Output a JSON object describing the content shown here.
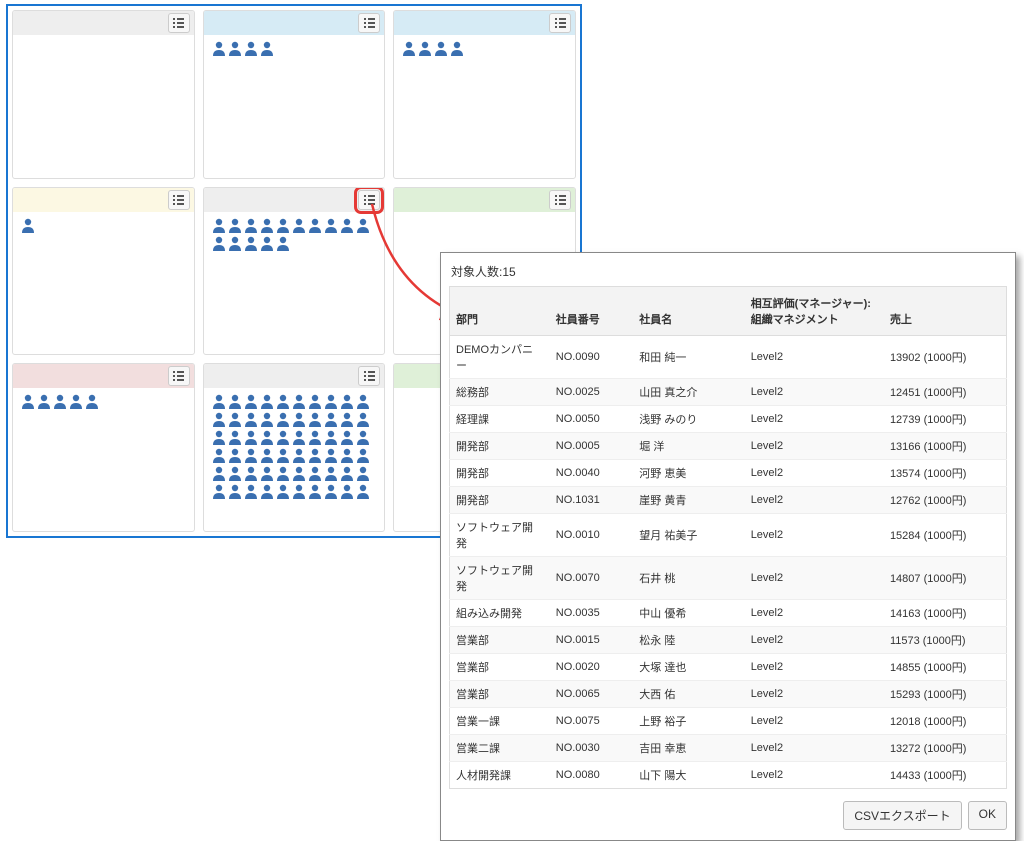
{
  "grid": {
    "cells": [
      {
        "header": "gray",
        "people": 0
      },
      {
        "header": "blue",
        "people": 4
      },
      {
        "header": "blue",
        "people": 4
      },
      {
        "header": "yellow",
        "people": 1
      },
      {
        "header": "gray",
        "people": 15,
        "highlight": true
      },
      {
        "header": "green",
        "people": 0
      },
      {
        "header": "red",
        "people": 5
      },
      {
        "header": "gray",
        "people": 60
      },
      {
        "header": "green",
        "people": 0
      }
    ]
  },
  "dialog": {
    "title": "対象人数:15",
    "columns": [
      "部門",
      "社員番号",
      "社員名",
      "相互評価(マネージャー): 組織マネジメント",
      "売上"
    ],
    "rows": [
      [
        "DEMOカンパニー",
        "NO.0090",
        "和田 純一",
        "Level2",
        "13902 (1000円)"
      ],
      [
        "総務部",
        "NO.0025",
        "山田 真之介",
        "Level2",
        "12451 (1000円)"
      ],
      [
        "経理課",
        "NO.0050",
        "浅野 みのり",
        "Level2",
        "12739 (1000円)"
      ],
      [
        "開発部",
        "NO.0005",
        "堀 洋",
        "Level2",
        "13166 (1000円)"
      ],
      [
        "開発部",
        "NO.0040",
        "河野 恵美",
        "Level2",
        "13574 (1000円)"
      ],
      [
        "開発部",
        "NO.1031",
        "崖野 黄青",
        "Level2",
        "12762 (1000円)"
      ],
      [
        "ソフトウェア開発",
        "NO.0010",
        "望月 祐美子",
        "Level2",
        "15284 (1000円)"
      ],
      [
        "ソフトウェア開発",
        "NO.0070",
        "石井 桃",
        "Level2",
        "14807 (1000円)"
      ],
      [
        "組み込み開発",
        "NO.0035",
        "中山 優希",
        "Level2",
        "14163 (1000円)"
      ],
      [
        "営業部",
        "NO.0015",
        "松永 陸",
        "Level2",
        "11573 (1000円)"
      ],
      [
        "営業部",
        "NO.0020",
        "大塚 達也",
        "Level2",
        "14855 (1000円)"
      ],
      [
        "営業部",
        "NO.0065",
        "大西 佑",
        "Level2",
        "15293 (1000円)"
      ],
      [
        "営業一課",
        "NO.0075",
        "上野 裕子",
        "Level2",
        "12018 (1000円)"
      ],
      [
        "営業二課",
        "NO.0030",
        "吉田 幸恵",
        "Level2",
        "13272 (1000円)"
      ],
      [
        "人材開発課",
        "NO.0080",
        "山下 陽大",
        "Level2",
        "14433 (1000円)"
      ]
    ],
    "buttons": {
      "csv": "CSVエクスポート",
      "ok": "OK"
    }
  }
}
